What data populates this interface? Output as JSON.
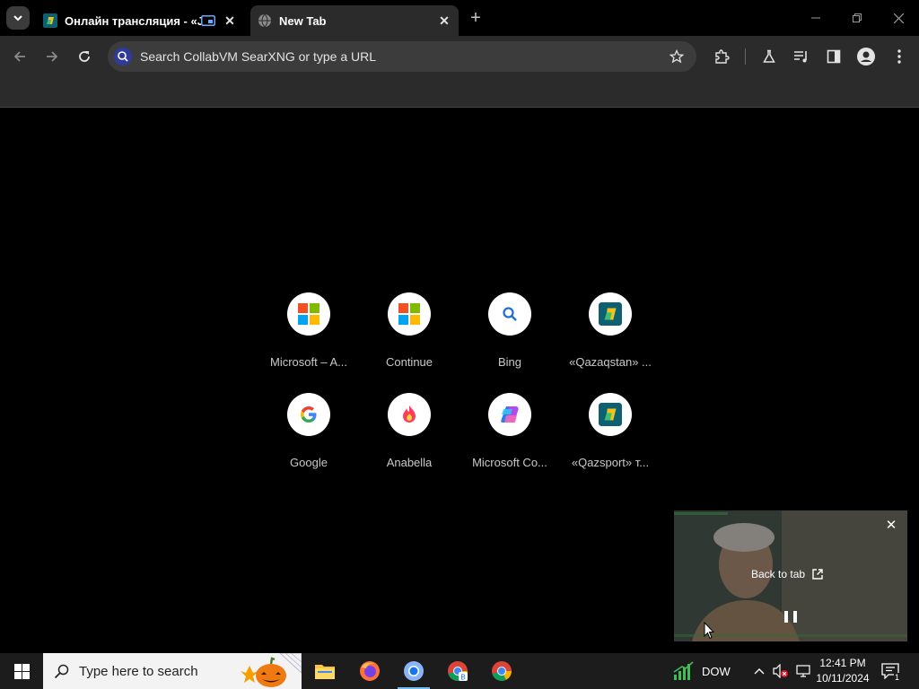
{
  "browser": {
    "tabs": [
      {
        "title": "Онлайн трансляция - «JAI",
        "active": false,
        "playing_pip": true
      },
      {
        "title": "New Tab",
        "active": true
      }
    ],
    "omnibox": {
      "placeholder": "Search CollabVM SearXNG or type a URL"
    }
  },
  "shortcuts": [
    {
      "label": "Microsoft – A...",
      "icon": "microsoft-logo-icon"
    },
    {
      "label": "Continue",
      "icon": "microsoft-logo-icon"
    },
    {
      "label": "Bing",
      "icon": "search-icon"
    },
    {
      "label": "«Qazaqstan» ...",
      "icon": "qazaqstan-logo-icon"
    },
    {
      "label": "Google",
      "icon": "google-logo-icon"
    },
    {
      "label": "Anabella",
      "icon": "flame-icon"
    },
    {
      "label": "Microsoft Co...",
      "icon": "copilot-icon"
    },
    {
      "label": "«Qazsport» т...",
      "icon": "qazsport-logo-icon"
    }
  ],
  "pip": {
    "back_to_tab": "Back to tab"
  },
  "taskbar": {
    "search_placeholder": "Type here to search",
    "stock_ticker": "DOW",
    "time": "12:41 PM",
    "date": "10/11/2024",
    "notification_count": "1"
  },
  "colors": {
    "tab_bg": "#2b2b2b",
    "omnibox_bg": "#3c3c3c",
    "accent": "#76b9ed"
  }
}
